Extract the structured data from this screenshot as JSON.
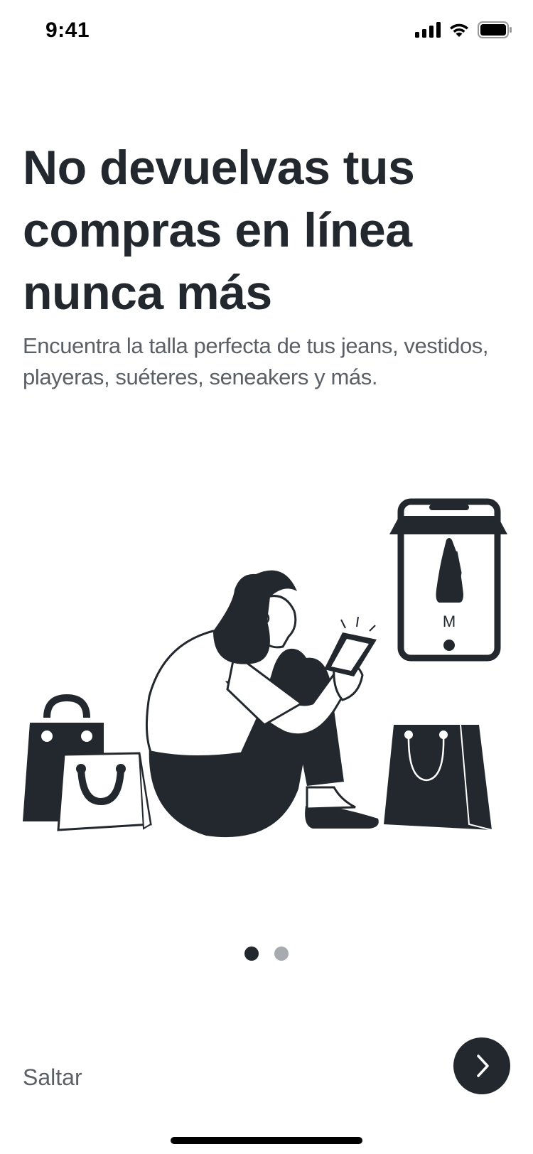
{
  "status_bar": {
    "time": "9:41",
    "icons": [
      "cellular-signal-icon",
      "wifi-icon",
      "battery-icon"
    ]
  },
  "onboarding": {
    "title": "No devuelvas tus compras en línea nunca más",
    "subtitle": "Encuentra la talla perfecta de tus jeans, vestidos, playeras, suéteres, seneakers y más.",
    "illustration": {
      "description_icons": [
        "shopping-bag-icon",
        "person-icon",
        "phone-icon",
        "dress-icon"
      ],
      "size_label": "M"
    },
    "pager": {
      "current": 1,
      "total": 2
    },
    "skip_label": "Saltar",
    "next_icon": "chevron-right-icon"
  },
  "colors": {
    "primary": "#23282e",
    "secondary_text": "#5b6067",
    "inactive_dot": "#a7aaae",
    "background": "#ffffff"
  }
}
